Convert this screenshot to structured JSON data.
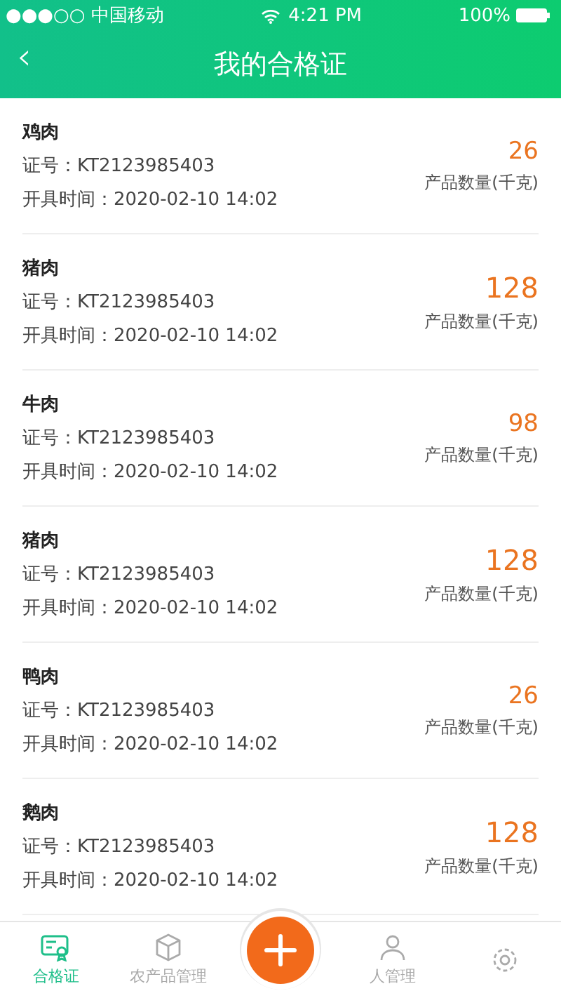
{
  "status_bar": {
    "carrier": "●●●○○ 中国移动",
    "time": "4:21 PM",
    "battery": "100%"
  },
  "header": {
    "back": "‹",
    "title": "我的合格证"
  },
  "certificates": [
    {
      "name": "鸡肉",
      "cert_no": "证号：KT2123985403",
      "issued": "开具时间：2020-02-10 14:02",
      "quantity": "26",
      "quantity_label": "产品数量(千克)"
    },
    {
      "name": "猪肉",
      "cert_no": "证号：KT2123985403",
      "issued": "开具时间：2020-02-10 14:02",
      "quantity": "128",
      "quantity_label": "产品数量(千克)"
    },
    {
      "name": "牛肉",
      "cert_no": "证号：KT2123985403",
      "issued": "开具时间：2020-02-10 14:02",
      "quantity": "98",
      "quantity_label": "产品数量(千克)"
    },
    {
      "name": "猪肉",
      "cert_no": "证号：KT2123985403",
      "issued": "开具时间：2020-02-10 14:02",
      "quantity": "128",
      "quantity_label": "产品数量(千克)"
    },
    {
      "name": "鸭肉",
      "cert_no": "证号：KT2123985403",
      "issued": "开具时间：2020-02-10 14:02",
      "quantity": "26",
      "quantity_label": "产品数量(千克)"
    },
    {
      "name": "鹅肉",
      "cert_no": "证号：KT2123985403",
      "issued": "开具时间：2020-02-10 14:02",
      "quantity": "128",
      "quantity_label": "产品数量(千克)"
    }
  ],
  "tab_bar": {
    "tabs": [
      {
        "kind": "certificate",
        "label": "合格证",
        "selected": true
      },
      {
        "kind": "box",
        "label": "农产品管理",
        "selected": false
      },
      {
        "kind": "add",
        "selected": false
      },
      {
        "kind": "person",
        "label": "人管理",
        "selected": false
      },
      {
        "kind": "settings",
        "selected": false
      }
    ]
  }
}
